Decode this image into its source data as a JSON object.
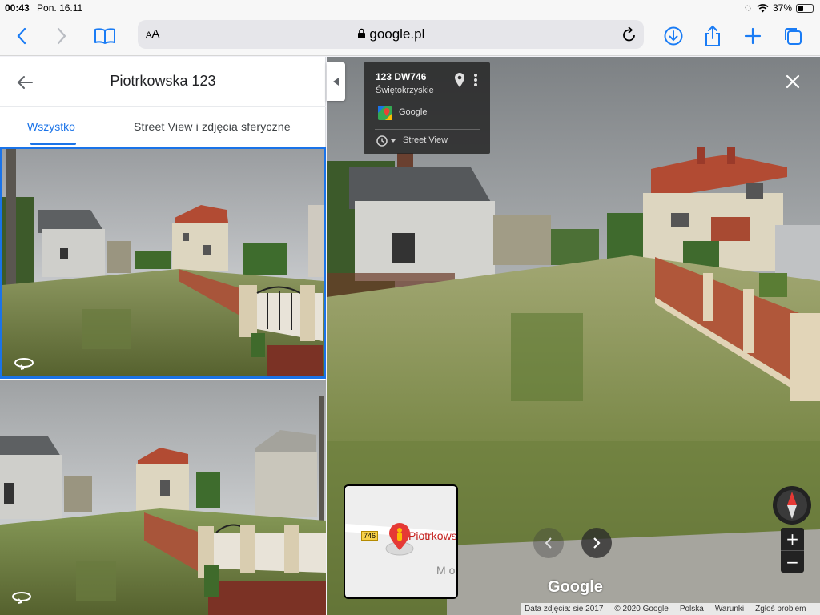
{
  "status_bar": {
    "time": "00:43",
    "date": "Pon. 16.11",
    "battery": "37%",
    "battery_level": 0.37
  },
  "browser": {
    "text_size": "AA",
    "url": "google.pl"
  },
  "left_panel": {
    "title": "Piotrkowska 123",
    "tabs": [
      {
        "label": "Wszystko",
        "selected": true
      },
      {
        "label": "Street View i zdjęcia sferyczne",
        "selected": false
      }
    ],
    "accent": "#1a73e8"
  },
  "info_card": {
    "title": "123 DW746",
    "region": "Świętokrzyskie",
    "provider": "Google",
    "mode": "Street View"
  },
  "minimap": {
    "road_shield": "746",
    "place_label": "Piotrkows",
    "area_label": "Mo"
  },
  "google_logo": "Google",
  "footer": {
    "capture_date": "Data zdjęcia: sie 2017",
    "copyright": "© 2020 Google",
    "country": "Polska",
    "terms": "Warunki",
    "report": "Zgłoś problem"
  },
  "icons": [
    "back-arrow-icon",
    "forward-arrow-icon",
    "bookmarks-icon",
    "lock-icon",
    "reload-icon",
    "download-icon",
    "share-icon",
    "new-tab-icon",
    "tabs-icon",
    "wifi-icon",
    "battery-icon",
    "panorama-icon",
    "pin-icon",
    "more-vert-icon",
    "history-icon",
    "close-icon",
    "pegman-icon",
    "compass-icon"
  ]
}
